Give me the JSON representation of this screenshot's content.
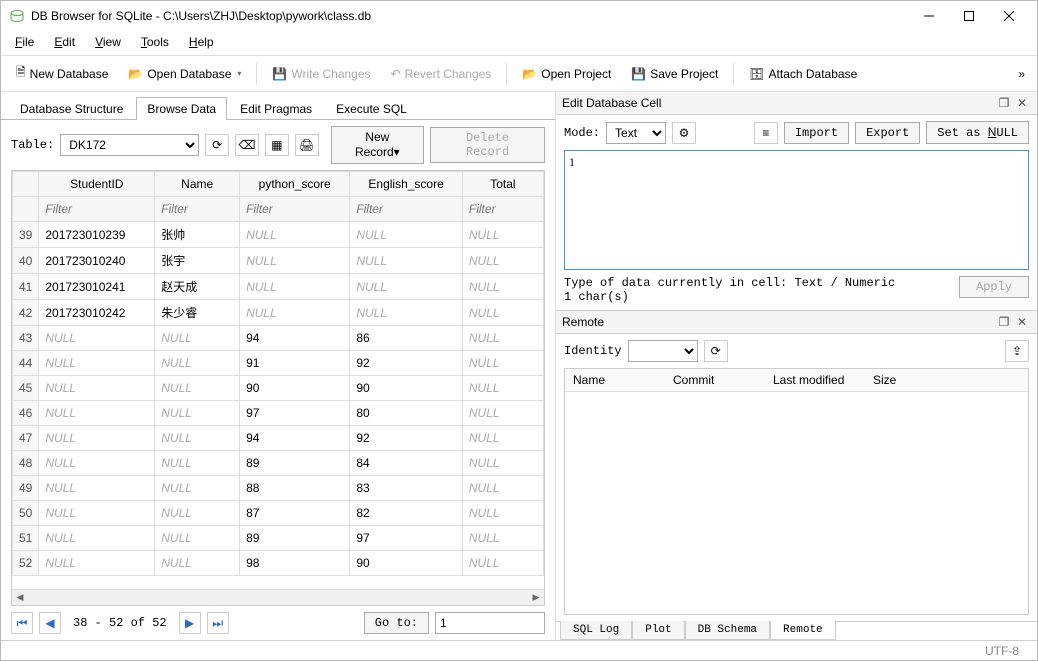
{
  "window": {
    "title": "DB Browser for SQLite - C:\\Users\\ZHJ\\Desktop\\pywork\\class.db"
  },
  "menus": {
    "file": "File",
    "edit": "Edit",
    "view": "View",
    "tools": "Tools",
    "help": "Help"
  },
  "toolbar": {
    "new_db": "New Database",
    "open_db": "Open Database",
    "write_changes": "Write Changes",
    "revert_changes": "Revert Changes",
    "open_project": "Open Project",
    "save_project": "Save Project",
    "attach_db": "Attach Database"
  },
  "tabs": {
    "struct": "Database Structure",
    "browse": "Browse Data",
    "pragmas": "Edit Pragmas",
    "sql": "Execute SQL"
  },
  "browse": {
    "table_label": "Table:",
    "table_selected": "DK172",
    "new_record": "New Record",
    "delete_record": "Delete Record",
    "columns": [
      "StudentID",
      "Name",
      "python_score",
      "English_score",
      "Total"
    ],
    "filter_placeholder": "Filter",
    "rows": [
      {
        "n": "39",
        "c": [
          "201723010239",
          "张帅",
          "NULL",
          "NULL",
          "NULL"
        ]
      },
      {
        "n": "40",
        "c": [
          "201723010240",
          "张宇",
          "NULL",
          "NULL",
          "NULL"
        ]
      },
      {
        "n": "41",
        "c": [
          "201723010241",
          "赵天成",
          "NULL",
          "NULL",
          "NULL"
        ]
      },
      {
        "n": "42",
        "c": [
          "201723010242",
          "朱少睿",
          "NULL",
          "NULL",
          "NULL"
        ]
      },
      {
        "n": "43",
        "c": [
          "NULL",
          "NULL",
          "94",
          "86",
          "NULL"
        ]
      },
      {
        "n": "44",
        "c": [
          "NULL",
          "NULL",
          "91",
          "92",
          "NULL"
        ]
      },
      {
        "n": "45",
        "c": [
          "NULL",
          "NULL",
          "90",
          "90",
          "NULL"
        ]
      },
      {
        "n": "46",
        "c": [
          "NULL",
          "NULL",
          "97",
          "80",
          "NULL"
        ]
      },
      {
        "n": "47",
        "c": [
          "NULL",
          "NULL",
          "94",
          "92",
          "NULL"
        ]
      },
      {
        "n": "48",
        "c": [
          "NULL",
          "NULL",
          "89",
          "84",
          "NULL"
        ]
      },
      {
        "n": "49",
        "c": [
          "NULL",
          "NULL",
          "88",
          "83",
          "NULL"
        ]
      },
      {
        "n": "50",
        "c": [
          "NULL",
          "NULL",
          "87",
          "82",
          "NULL"
        ]
      },
      {
        "n": "51",
        "c": [
          "NULL",
          "NULL",
          "89",
          "97",
          "NULL"
        ]
      },
      {
        "n": "52",
        "c": [
          "NULL",
          "NULL",
          "98",
          "90",
          "NULL"
        ]
      }
    ],
    "pager_info": "38 - 52 of 52",
    "goto_label": "Go to:",
    "goto_value": "1"
  },
  "editcell": {
    "title": "Edit Database Cell",
    "mode_label": "Mode:",
    "mode_value": "Text",
    "import": "Import",
    "export": "Export",
    "set_null": "Set as NULL",
    "content": "1",
    "type_line1": "Type of data currently in cell: Text / Numeric",
    "type_line2": "1 char(s)",
    "apply": "Apply"
  },
  "remote": {
    "title": "Remote",
    "identity_label": "Identity",
    "cols": {
      "name": "Name",
      "commit": "Commit",
      "last_modified": "Last modified",
      "size": "Size"
    }
  },
  "bottom_tabs": {
    "sqllog": "SQL Log",
    "plot": "Plot",
    "schema": "DB Schema",
    "remote": "Remote"
  },
  "status": {
    "encoding": "UTF-8"
  }
}
